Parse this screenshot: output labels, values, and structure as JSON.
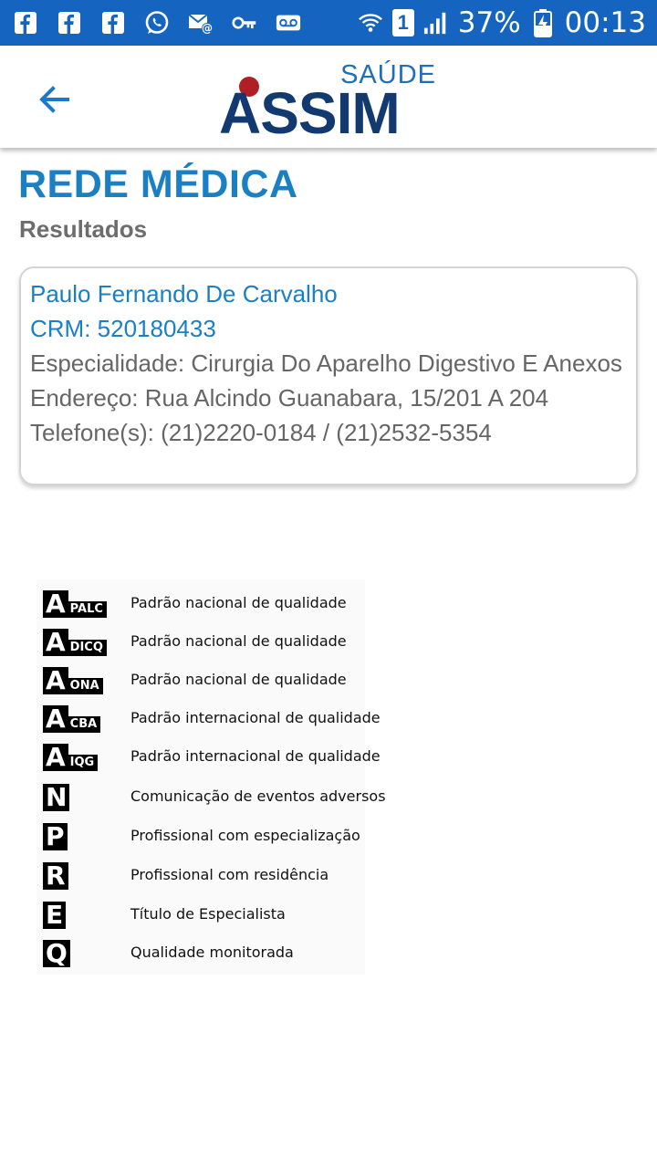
{
  "status_bar": {
    "battery": "37%",
    "time": "00:13",
    "sim": "1",
    "left_icons": [
      "facebook-icon",
      "facebook-icon",
      "facebook-icon",
      "whatsapp-icon",
      "email-icon",
      "vpn-key-icon",
      "voicemail-icon"
    ],
    "right_icons": [
      "wifi-icon",
      "sim-icon",
      "signal-icon",
      "battery-charging-icon"
    ],
    "color": "#1565c0"
  },
  "app_bar": {
    "logo_top": "SAÚDE",
    "logo_main": "ASSIM",
    "back_icon": "arrow-back-icon"
  },
  "page": {
    "title": "REDE MÉDICA",
    "subtitle": "Resultados"
  },
  "result": {
    "name": "Paulo Fernando De Carvalho",
    "crm": "CRM: 520180433",
    "specialty": "Especialidade: Cirurgia Do Aparelho Digestivo E Anexos",
    "address": "Endereço: Rua Alcindo Guanabara, 15/201 A 204",
    "phones": "Telefone(s): (21)2220-0184 / (21)2532-5354"
  },
  "legend": [
    {
      "letter": "A",
      "tag": "PALC",
      "text": "Padrão nacional de qualidade"
    },
    {
      "letter": "A",
      "tag": "DICQ",
      "text": "Padrão nacional de qualidade"
    },
    {
      "letter": "A",
      "tag": "ONA",
      "text": "Padrão nacional de qualidade"
    },
    {
      "letter": "A",
      "tag": "CBA",
      "text": "Padrão internacional de qualidade"
    },
    {
      "letter": "A",
      "tag": "IQG",
      "text": "Padrão internacional de qualidade"
    },
    {
      "letter": "N",
      "tag": "",
      "text": "Comunicação de eventos adversos"
    },
    {
      "letter": "P",
      "tag": "",
      "text": "Profissional com especialização"
    },
    {
      "letter": "R",
      "tag": "",
      "text": "Profissional com residência"
    },
    {
      "letter": "E",
      "tag": "",
      "text": "Título de Especialista"
    },
    {
      "letter": "Q",
      "tag": "",
      "text": "Qualidade monitorada"
    }
  ],
  "colors": {
    "accent": "#1b7fc4",
    "logo_navy": "#123a70",
    "logo_red": "#b01f24"
  }
}
